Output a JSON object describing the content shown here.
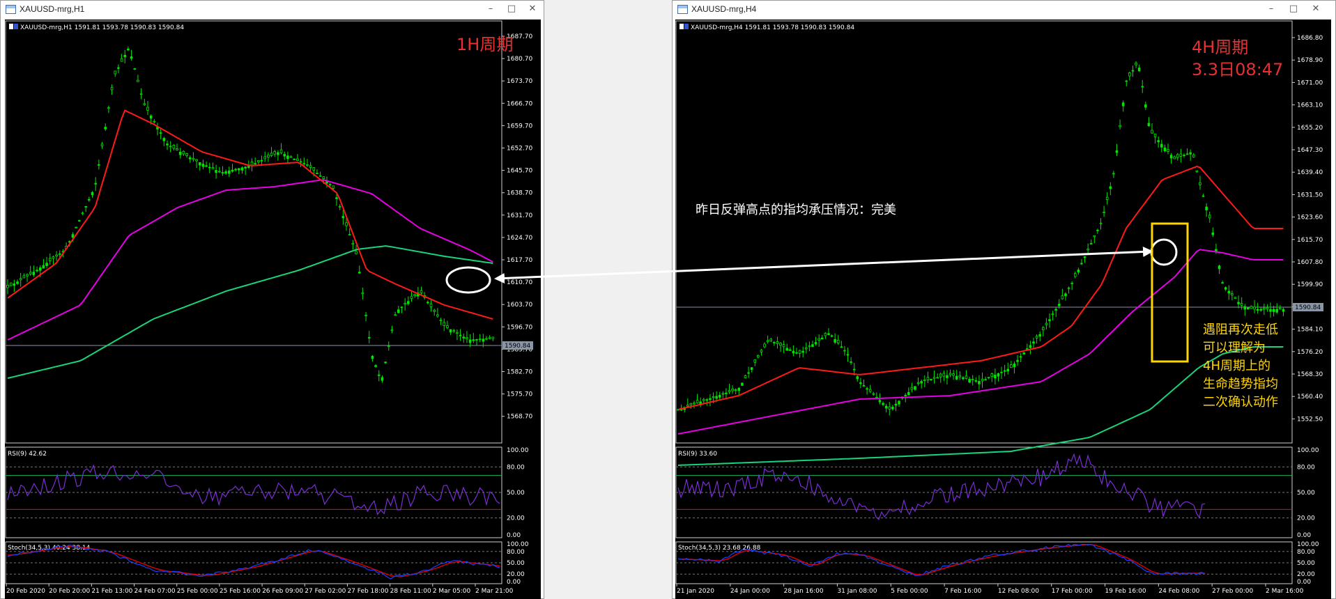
{
  "windows": [
    {
      "title": "XAUUSD-mrg,H1",
      "header": "XAUUSD-mrg,H1  1591.81 1593.78 1590.83 1590.84",
      "price_ticks": [
        "1687.70",
        "1680.70",
        "1673.70",
        "1666.70",
        "1659.70",
        "1652.70",
        "1645.70",
        "1638.70",
        "1631.70",
        "1624.70",
        "1617.70",
        "1610.70",
        "1603.70",
        "1596.70",
        "1589.70",
        "1582.70",
        "1575.70",
        "1568.70"
      ],
      "price_label": "1590.84",
      "rsi_header": "RSI(9) 42.62",
      "stoch_header": "Stoch(34,5,3) 40.24 38.14",
      "rsi_ticks": [
        "100.00",
        "80.00",
        "50.00",
        "20.00",
        "0.00"
      ],
      "stoch_ticks": [
        "100.00",
        "80.00",
        "50.00",
        "20.00",
        "0.00"
      ],
      "time_labels": [
        "20 Feb 2020",
        "20 Feb 20:00",
        "21 Feb 13:00",
        "24 Feb 07:00",
        "25 Feb 00:00",
        "25 Feb 16:00",
        "26 Feb 09:00",
        "27 Feb 02:00",
        "27 Feb 18:00",
        "28 Feb 11:00",
        "2 Mar 05:00",
        "2 Mar 21:00"
      ],
      "period_label": "1H周期",
      "period_sub": ""
    },
    {
      "title": "XAUUSD-mrg,H4",
      "header": "XAUUSD-mrg,H4  1591.81 1593.78 1590.83 1590.84",
      "price_ticks": [
        "1686.80",
        "1678.90",
        "1671.00",
        "1663.10",
        "1655.20",
        "1647.30",
        "1639.40",
        "1631.50",
        "1623.60",
        "1615.70",
        "1607.80",
        "1599.90",
        "1592.00",
        "1584.10",
        "1576.20",
        "1568.30",
        "1560.40",
        "1552.50"
      ],
      "price_label": "1590.84",
      "rsi_header": "RSI(9) 33.60",
      "stoch_header": "Stoch(34,5,3) 23.68 26.88",
      "rsi_ticks": [
        "100.00",
        "80.00",
        "50.00",
        "20.00",
        "0.00"
      ],
      "stoch_ticks": [
        "100.00",
        "80.00",
        "50.00",
        "20.00",
        "0.00"
      ],
      "time_labels": [
        "21 Jan 2020",
        "24 Jan 00:00",
        "28 Jan 16:00",
        "31 Jan 08:00",
        "5 Feb 00:00",
        "7 Feb 16:00",
        "12 Feb 08:00",
        "17 Feb 00:00",
        "19 Feb 16:00",
        "24 Feb 08:00",
        "27 Feb 00:00",
        "2 Mar 16:00"
      ],
      "period_label": "4H周期",
      "period_sub": "3.3日08:47"
    }
  ],
  "annotations": {
    "middle_note": "昨日反弹高点的指均承压情况：完美",
    "right_note": [
      "遇阻再次走低",
      "可以理解为",
      "4H周期上的",
      "生命趋势指均",
      "二次确认动作"
    ]
  },
  "window_buttons": {
    "minimize": "–",
    "maximize": "□",
    "close": "✕"
  },
  "colors": {
    "candles": "#00e600",
    "ma_fast": "#ff1a1a",
    "ma_mid": "#e600e6",
    "ma_slow": "#19d47a",
    "rsi_line": "#7a2fd6",
    "stoch_main": "#1a3fff",
    "stoch_signal": "#e00000",
    "annotation_red": "#e83030",
    "annotation_yellow": "#ffd500"
  }
}
